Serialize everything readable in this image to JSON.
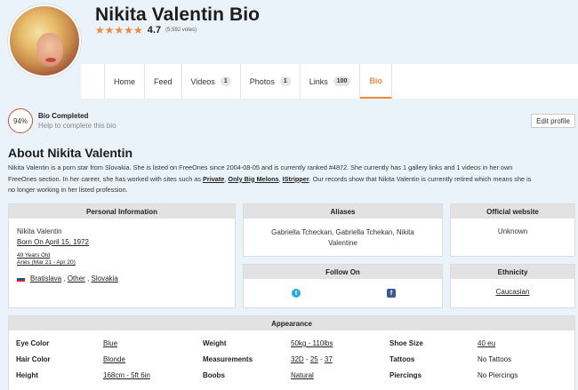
{
  "profile": {
    "name": "Nikita Valentin Bio",
    "rating_value": "4.7",
    "votes": "(5,592 votes)"
  },
  "tabs": [
    {
      "label": "Home",
      "badge": ""
    },
    {
      "label": "Feed",
      "badge": ""
    },
    {
      "label": "Videos",
      "badge": "1"
    },
    {
      "label": "Photos",
      "badge": "1"
    },
    {
      "label": "Links",
      "badge": "100"
    },
    {
      "label": "Bio",
      "badge": "",
      "active": true
    }
  ],
  "bio_status": {
    "percent": "94%",
    "title": "Bio Completed",
    "subtitle": "Help to complete this bio",
    "edit_label": "Edit profile"
  },
  "about": {
    "title": "About Nikita Valentin",
    "line1": "Nikita Valentin is a porn star from Slovakia. She is listed on FreeOnes since 2004-08-05 and is currently ranked #4872. She currently has 1 gallery links and 1 videos in her own",
    "line2_prefix": "FreeOnes section. In her career, she has worked with sites such as ",
    "site1": "Private",
    "site2": "Only Big Melons",
    "site3": "IStripper",
    "line2_suffix": ". Our records show that Nikita Valentin is currently retired which means she is",
    "line3": "no longer working in her listed profession."
  },
  "personal": {
    "header": "Personal Information",
    "name": "Nikita Valentin",
    "born": "Born On April 15, 1972",
    "age": "49 Years Old",
    "sign": "Aries (Mar 21 - Apr 20)",
    "city": "Bratislava",
    "region": "Other",
    "country": "Slovakia",
    "sep": ",",
    "flag_icon": "slovakia-flag-icon"
  },
  "aliases": {
    "header": "Aliases",
    "text": "Gabriella Tcheckan, Gabriella Tchekan, Nikita Valentine"
  },
  "website": {
    "header": "Official website",
    "value": "Unknown"
  },
  "follow": {
    "header": "Follow On",
    "twitter_glyph": "t",
    "facebook_glyph": "f"
  },
  "ethnicity": {
    "header": "Ethnicity",
    "value": "Caucasian"
  },
  "appearance": {
    "header": "Appearance",
    "eye_label": "Eye Color",
    "eye_value": "Blue",
    "hair_label": "Hair Color",
    "hair_value": "Blonde",
    "height_label": "Height",
    "height_value": "168cm - 5ft 6in",
    "weight_label": "Weight",
    "weight_value": "50kg - 110lbs",
    "meas_label": "Measurements",
    "meas_1": "32D",
    "meas_2": "25",
    "meas_3": "37",
    "meas_sep": "-",
    "boobs_label": "Boobs",
    "boobs_value": "Natural",
    "shoe_label": "Shoe Size",
    "shoe_value": "40 eu",
    "tattoo_label": "Tattoos",
    "tattoo_value": "No Tattoos",
    "pierce_label": "Piercings",
    "pierce_value": "No Piercings"
  },
  "colors": {
    "accent": "#f0883e",
    "page_bg": "#eaf3fa",
    "card_head": "#e2e2e2"
  }
}
